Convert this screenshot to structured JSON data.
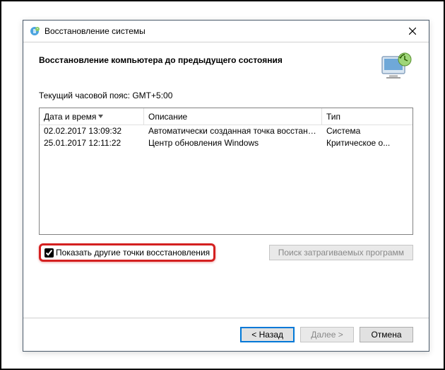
{
  "window": {
    "title": "Восстановление системы"
  },
  "header": {
    "title": "Восстановление компьютера до предыдущего состояния"
  },
  "content": {
    "timezone_label": "Текущий часовой пояс: GMT+5:00",
    "columns": {
      "date": "Дата и время",
      "desc": "Описание",
      "type": "Тип"
    },
    "rows": [
      {
        "date": "02.02.2017 13:09:32",
        "desc": "Автоматически созданная точка восстановле...",
        "type": "Система"
      },
      {
        "date": "25.01.2017 12:11:22",
        "desc": "Центр обновления Windows",
        "type": "Критическое о..."
      }
    ],
    "checkbox_label": "Показать другие точки восстановления",
    "scan_button": "Поиск затрагиваемых программ"
  },
  "footer": {
    "back": "< Назад",
    "next": "Далее >",
    "cancel": "Отмена"
  }
}
